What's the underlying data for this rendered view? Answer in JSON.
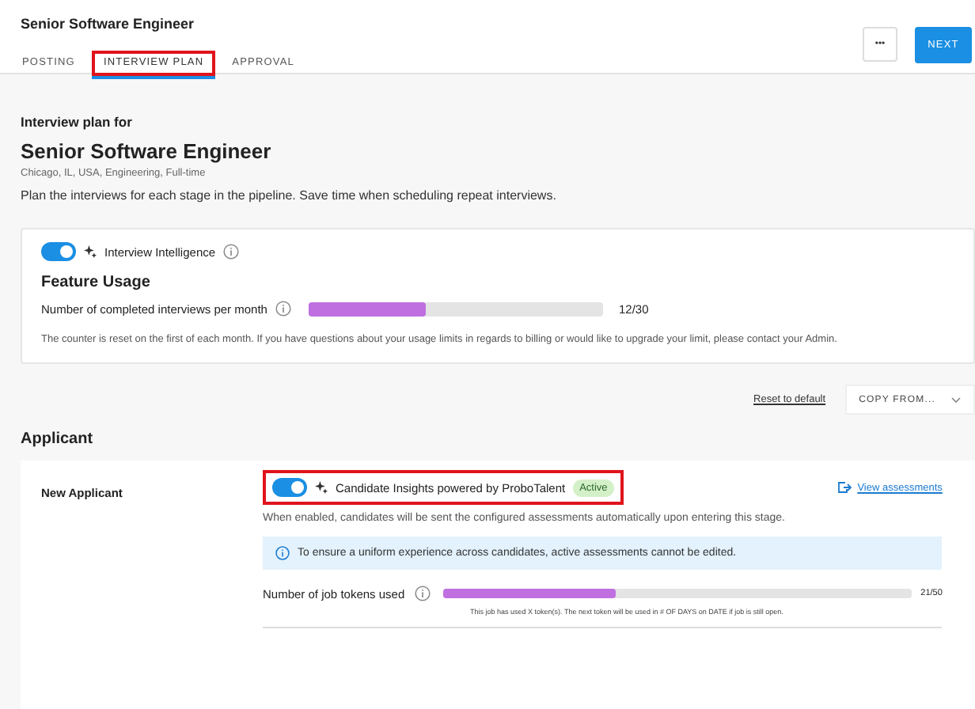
{
  "header": {
    "title": "Senior Software Engineer",
    "tabs": [
      {
        "label": "POSTING",
        "selected": false,
        "highlighted": false
      },
      {
        "label": "INTERVIEW PLAN",
        "selected": true,
        "highlighted": true
      },
      {
        "label": "APPROVAL",
        "selected": false,
        "highlighted": false
      }
    ],
    "more_button": "•••",
    "next_button": "NEXT"
  },
  "intro": {
    "eyebrow": "Interview plan for",
    "title": "Senior Software Engineer",
    "meta": "Chicago, IL, USA, Engineering, Full-time",
    "description": "Plan the interviews for each stage in the pipeline. Save time when scheduling repeat interviews."
  },
  "intelligence": {
    "toggle_on": true,
    "label": "Interview Intelligence",
    "heading": "Feature Usage",
    "usage_label": "Number of completed interviews per month",
    "level": 0.4,
    "reading": "12/30",
    "note": "The counter is reset on the first of each month. If you have questions about your usage limits in regards to billing or would like to upgrade your limit, please contact your Admin."
  },
  "actions": {
    "reset_link": "Reset to default",
    "copy_button": "COPY FROM..."
  },
  "section": {
    "title": "Applicant",
    "stage": "New Applicant",
    "insights": {
      "toggle_on": true,
      "highlighted": true,
      "label": "Candidate Insights powered by ProboTalent",
      "badge": "Active",
      "link": "View assessments",
      "description": "When enabled, candidates will be sent the configured assessments automatically upon entering this stage.",
      "notice": "To ensure a uniform experience across candidates, active assessments cannot be edited.",
      "tokens_label": "Number of job tokens used",
      "level": 0.37,
      "reading": "21/50",
      "tokens_note": "This job has used X token(s). The next token will be used in # OF DAYS on DATE if job is still open."
    }
  }
}
